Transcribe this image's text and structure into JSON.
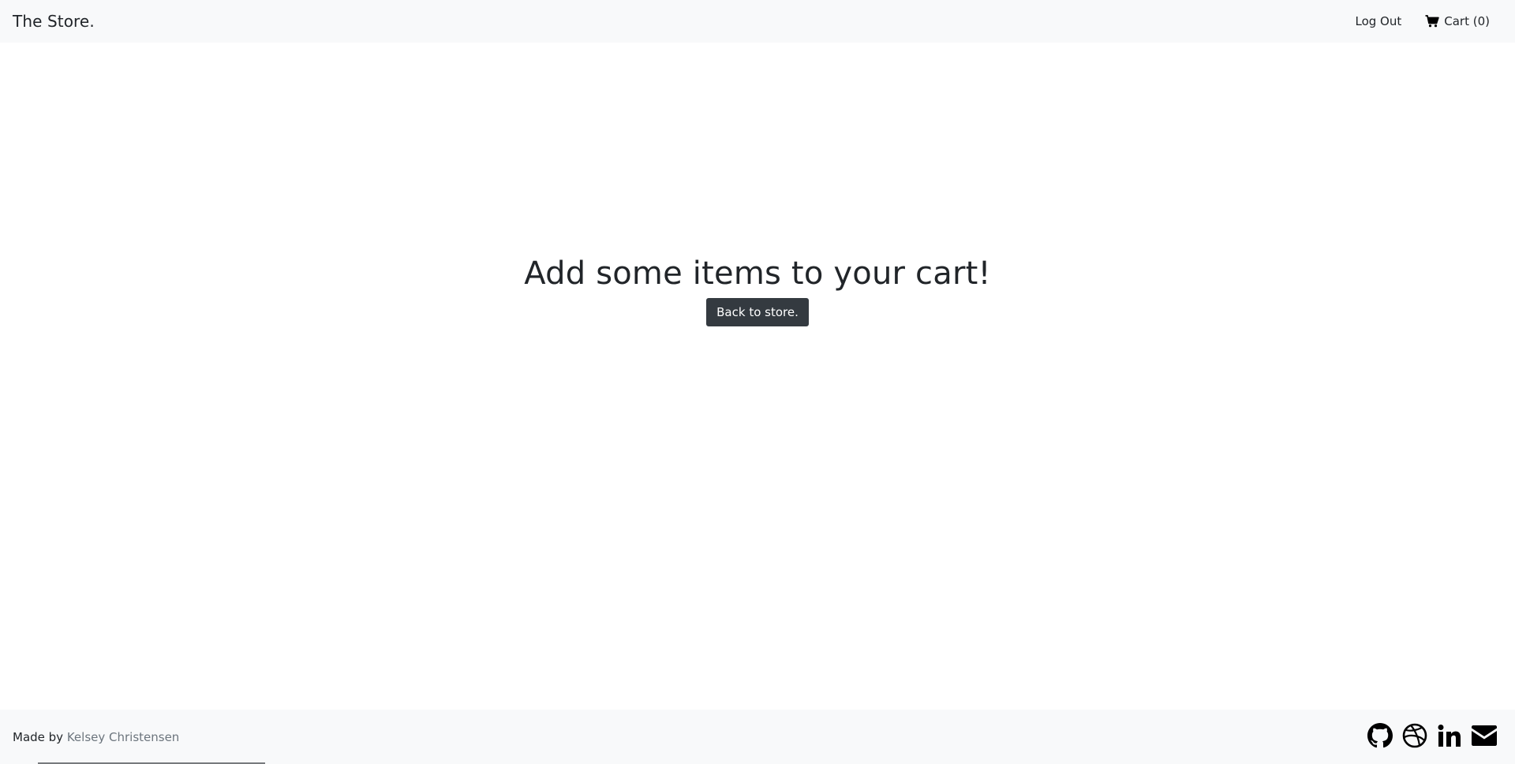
{
  "navbar": {
    "brand": "The Store.",
    "logout_label": "Log Out",
    "cart_label": "Cart (0)",
    "cart_icon": "shopping-cart-icon"
  },
  "main": {
    "heading": "Add some items to your cart!",
    "back_button_label": "Back to store."
  },
  "footer": {
    "made_by_prefix": "Made by",
    "author_name": "Kelsey Christensen",
    "social_icons": [
      "github-icon",
      "dribbble-icon",
      "linkedin-icon",
      "email-icon"
    ]
  },
  "colors": {
    "navbar_bg": "#f8f9fa",
    "footer_bg": "#f8f9fa",
    "button_bg": "#343a40",
    "text": "#212529",
    "link_muted": "#6c757d"
  }
}
